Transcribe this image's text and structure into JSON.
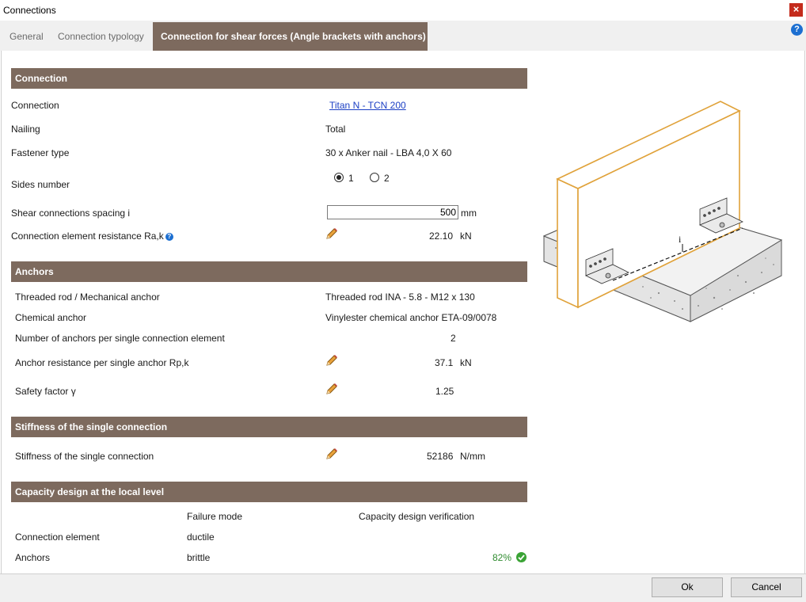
{
  "window": {
    "title": "Connections",
    "close": "×"
  },
  "tabs": [
    "General",
    "Connection typology",
    "Connection for shear forces (Angle brackets with anchors)"
  ],
  "help": "?",
  "sections": {
    "connection": "Connection",
    "anchors": "Anchors",
    "stiffness": "Stiffness of the single connection",
    "capacity": "Capacity design at the local level"
  },
  "connection": {
    "connection_label": "Connection",
    "connection_value": "Titan N - TCN 200",
    "nailing_label": "Nailing",
    "nailing_value": "Total",
    "fastener_label": "Fastener type",
    "fastener_value": "30  x  Anker nail - LBA 4,0 X 60",
    "sides_label": "Sides number",
    "sides_option_1": "1",
    "sides_option_2": "2",
    "spacing_label": "Shear connections spacing i",
    "spacing_value": "500",
    "spacing_unit": "mm",
    "resistance_label": "Connection element resistance Ra,k",
    "resistance_value": "22.10",
    "resistance_unit": "kN"
  },
  "anchors": {
    "rod_label": "Threaded rod / Mechanical anchor",
    "rod_value": "Threaded rod INA - 5.8 - M12 x 130",
    "chemical_label": "Chemical anchor",
    "chemical_value": "Vinylester chemical anchor ETA-09/0078",
    "count_label": "Number of anchors per single connection element",
    "count_value": "2",
    "resistance_label": "Anchor resistance per single anchor Rp,k",
    "resistance_value": "37.1",
    "resistance_unit": "kN",
    "safety_label": "Safety factor γ",
    "safety_value": "1.25"
  },
  "stiffness": {
    "label": "Stiffness of the single connection",
    "value": "52186",
    "unit": "N/mm"
  },
  "capacity": {
    "col_failure": "Failure mode",
    "col_verification": "Capacity design verification",
    "row1_label": "Connection element",
    "row1_failure": "ductile",
    "row2_label": "Anchors",
    "row2_failure": "brittle",
    "row2_verification": "82%"
  },
  "illustration": {
    "spacing_symbol": "i"
  },
  "footer": {
    "ok": "Ok",
    "cancel": "Cancel"
  },
  "colors": {
    "section": "#7d6a5e",
    "link": "#1b3fc4",
    "ok_green": "#3aa335",
    "wood": "#e0a23a"
  }
}
